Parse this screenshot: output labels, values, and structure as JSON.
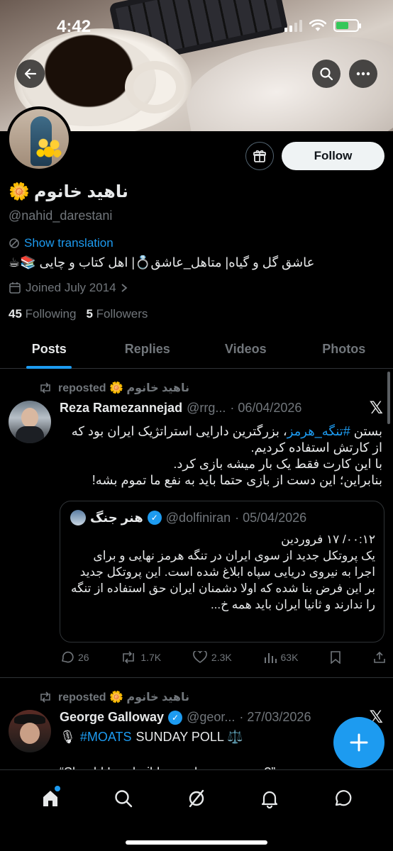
{
  "status_bar": {
    "time": "4:42"
  },
  "profile": {
    "name": "ناهید خانوم",
    "name_emoji": "🌼",
    "handle": "@nahid_darestani",
    "show_translation": "Show translation",
    "bio": "عاشق گل و گیاه| متاهل_عاشق💍| اهل کتاب و چایی 📚☕",
    "joined": "Joined July 2014",
    "following_count": "45",
    "following_label": "Following",
    "followers_count": "5",
    "followers_label": "Followers",
    "follow_label": "Follow"
  },
  "tabs": [
    "Posts",
    "Replies",
    "Videos",
    "Photos"
  ],
  "posts": [
    {
      "repost_label": "reposted 🌼 ناهید خانوم",
      "author": "Reza Ramezannejad",
      "handle": "@rrg...",
      "date": "· 06/04/2026",
      "text_line1_pre": "بستن ",
      "hashtag": "#تنگه_هرمز",
      "text_line1_post": "، بزرگترین دارایی استراتژیک ایران بود که",
      "text_rest": "از کارتش استفاده کردیم.\nبا این کارت فقط یک بار میشه بازی کرد.\nبنابراین؛ این دست از بازی حتما باید به نفع ما تموم بشه!",
      "quote": {
        "author": "هنر جنگ",
        "handle": "@dolfiniran",
        "date": "· 05/04/2026",
        "text": "۰۰:۱۲/ ۱۷ فروردین\nیک پروتکل جدید از سوی ایران در تنگه هرمز نهایی و برای اجرا به نیروی دریایی سپاه ابلاغ شده است. این پروتکل جدید بر این فرض بنا شده که اولا دشمنان ایران حق استفاده از تنگه را ندارند و ثانیا ایران باید همه خ..."
      },
      "replies": "26",
      "reposts": "1.7K",
      "likes": "2.3K",
      "views": "63K"
    },
    {
      "repost_label": "reposted 🌼 ناهید خانوم",
      "author": "George Galloway",
      "handle": "@geor...",
      "date": "· 27/03/2026",
      "hashtag": "#MOATS",
      "text_after_hashtag": "SUNDAY POLL ⚖️",
      "text_line2": "“Should Iran build a nuclear weapon?”"
    }
  ],
  "icons": {
    "back": "arrow-left",
    "search": "magnifier",
    "more": "ellipsis",
    "gift": "gift",
    "compose": "plus"
  },
  "colors": {
    "accent": "#1d9bf0",
    "muted": "#71767b",
    "text": "#e7e9ea",
    "background": "#000000"
  }
}
